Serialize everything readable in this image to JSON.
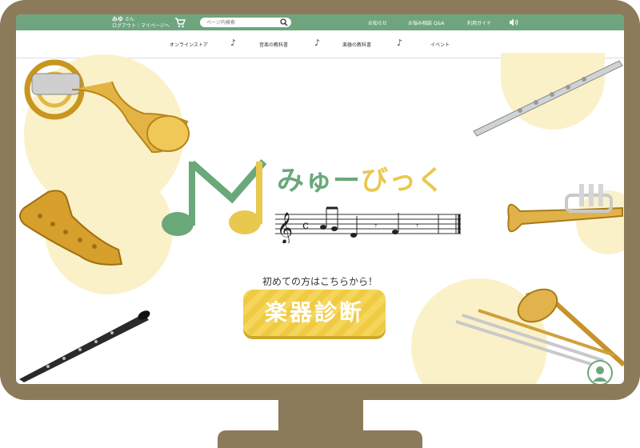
{
  "header": {
    "user_name": "みゆ",
    "user_suffix": "さん",
    "user_links": "ログアウト｜マイページへ",
    "search_placeholder": "ページ内検索",
    "links": [
      "お知らせ",
      "お悩み相談 Q&A",
      "利用ガイド"
    ]
  },
  "nav": {
    "items": [
      "オンラインストア",
      "音楽の教科書",
      "楽器の教科書",
      "イベント"
    ],
    "separator": "♪"
  },
  "hero": {
    "logo_text": "みゅーびっく",
    "cta_caption": "初めての方はこちらから！",
    "cta_button": "楽器診断"
  },
  "colors": {
    "green": "#6fa57e",
    "yellow": "#f5d65a",
    "frame": "#8b7b5a",
    "circle": "#fbf1c9",
    "brass": "#d9a52b"
  },
  "icons": [
    "cart-icon",
    "search-icon",
    "speaker-icon",
    "helper-avatar-icon"
  ]
}
